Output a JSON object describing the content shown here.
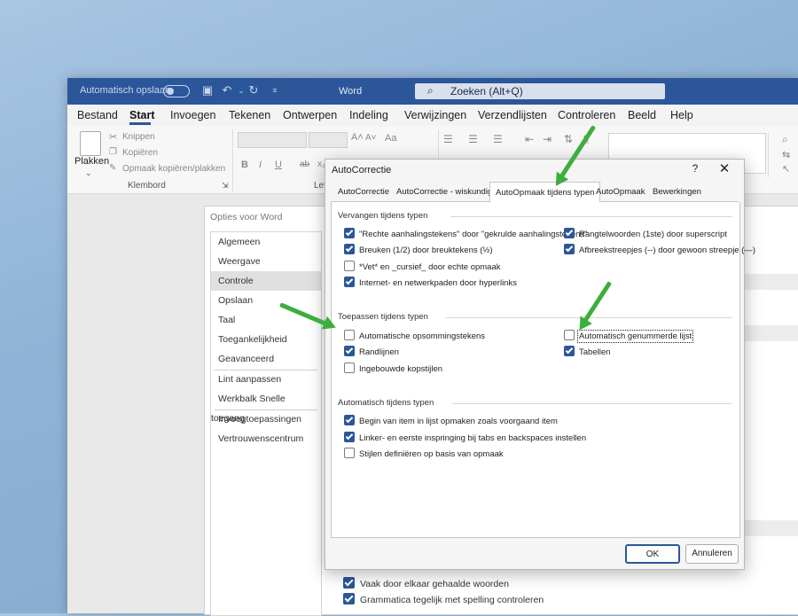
{
  "word": {
    "autosave_label": "Automatisch opslaan",
    "title": "Word",
    "search_placeholder": "Zoeken (Alt+Q)",
    "menu_tabs": [
      "Bestand",
      "Start",
      "Invoegen",
      "Tekenen",
      "Ontwerpen",
      "Indeling",
      "Verwijzingen",
      "Verzendlijsten",
      "Controleren",
      "Beeld",
      "Help"
    ],
    "active_tab": "Start",
    "ribbon": {
      "paste_label": "Plakken",
      "cut_label": "Knippen",
      "copy_label": "Kopiëren",
      "format_painter_label": "Opmaak kopiëren/plakken",
      "clipboard_group": "Klembord",
      "font_group_partial": "Lett",
      "font_size_big": "A˄",
      "font_size_small": "A˅",
      "case_label": "Aa",
      "bold": "B",
      "italic": "I",
      "underline": "U",
      "strike": "ab",
      "subscript": "x₂"
    }
  },
  "opties": {
    "title": "Opties voor Word",
    "nav": [
      "Algemeen",
      "Weergave",
      "Controle",
      "Opslaan",
      "Taal",
      "Toegankelijkheid",
      "Geavanceerd",
      "Lint aanpassen",
      "Werkbalk Snelle toegang",
      "Invoegtoepassingen",
      "Vertrouwenscentrum"
    ],
    "selected": "Controle",
    "bottom_options": [
      {
        "label": "Vaak door elkaar gehaalde woorden",
        "checked": true
      },
      {
        "label": "Grammatica tegelijk met spelling controleren",
        "checked": true
      }
    ]
  },
  "autocorrect": {
    "title": "AutoCorrectie",
    "help": "?",
    "close": "✕",
    "tabs": [
      "AutoCorrectie",
      "AutoCorrectie - wiskundig",
      "AutoOpmaak tijdens typen",
      "AutoOpmaak",
      "Bewerkingen"
    ],
    "active_tab": "AutoOpmaak tijdens typen",
    "section_replace": {
      "label": "Vervangen tijdens typen",
      "left": [
        {
          "label": "\"Rechte aanhalingstekens\" door \"gekrulde aanhalingstekens\"",
          "checked": true
        },
        {
          "label": "Breuken (1/2) door breuktekens (½)",
          "checked": true
        },
        {
          "label": "*Vet* en _cursief_ door echte opmaak",
          "checked": false
        },
        {
          "label": "Internet- en netwerkpaden door hyperlinks",
          "checked": true
        }
      ],
      "right": [
        {
          "label": "Rangtelwoorden (1ste) door superscript",
          "checked": true
        },
        {
          "label": "Afbreekstreepjes (--) door gewoon streepje (—)",
          "checked": true
        }
      ]
    },
    "section_apply": {
      "label": "Toepassen tijdens typen",
      "left": [
        {
          "label": "Automatische opsommingstekens",
          "checked": false
        },
        {
          "label": "Randlijnen",
          "checked": true
        },
        {
          "label": "Ingebouwde kopstijlen",
          "checked": false
        }
      ],
      "right": [
        {
          "label": "Automatisch genummerde lijst",
          "checked": false
        },
        {
          "label": "Tabellen",
          "checked": true
        }
      ]
    },
    "section_auto": {
      "label": "Automatisch tijdens typen",
      "items": [
        {
          "label": "Begin van item in lijst opmaken zoals voorgaand item",
          "checked": true
        },
        {
          "label": "Linker- en eerste inspringing bij tabs en backspaces instellen",
          "checked": true
        },
        {
          "label": "Stijlen definiëren op basis van opmaak",
          "checked": false
        }
      ]
    },
    "ok_label": "OK",
    "cancel_label": "Annuleren"
  },
  "colors": {
    "word_blue": "#2b579a",
    "arrow_green": "#3cae3c",
    "checkbox_blue": "#2b579a"
  }
}
